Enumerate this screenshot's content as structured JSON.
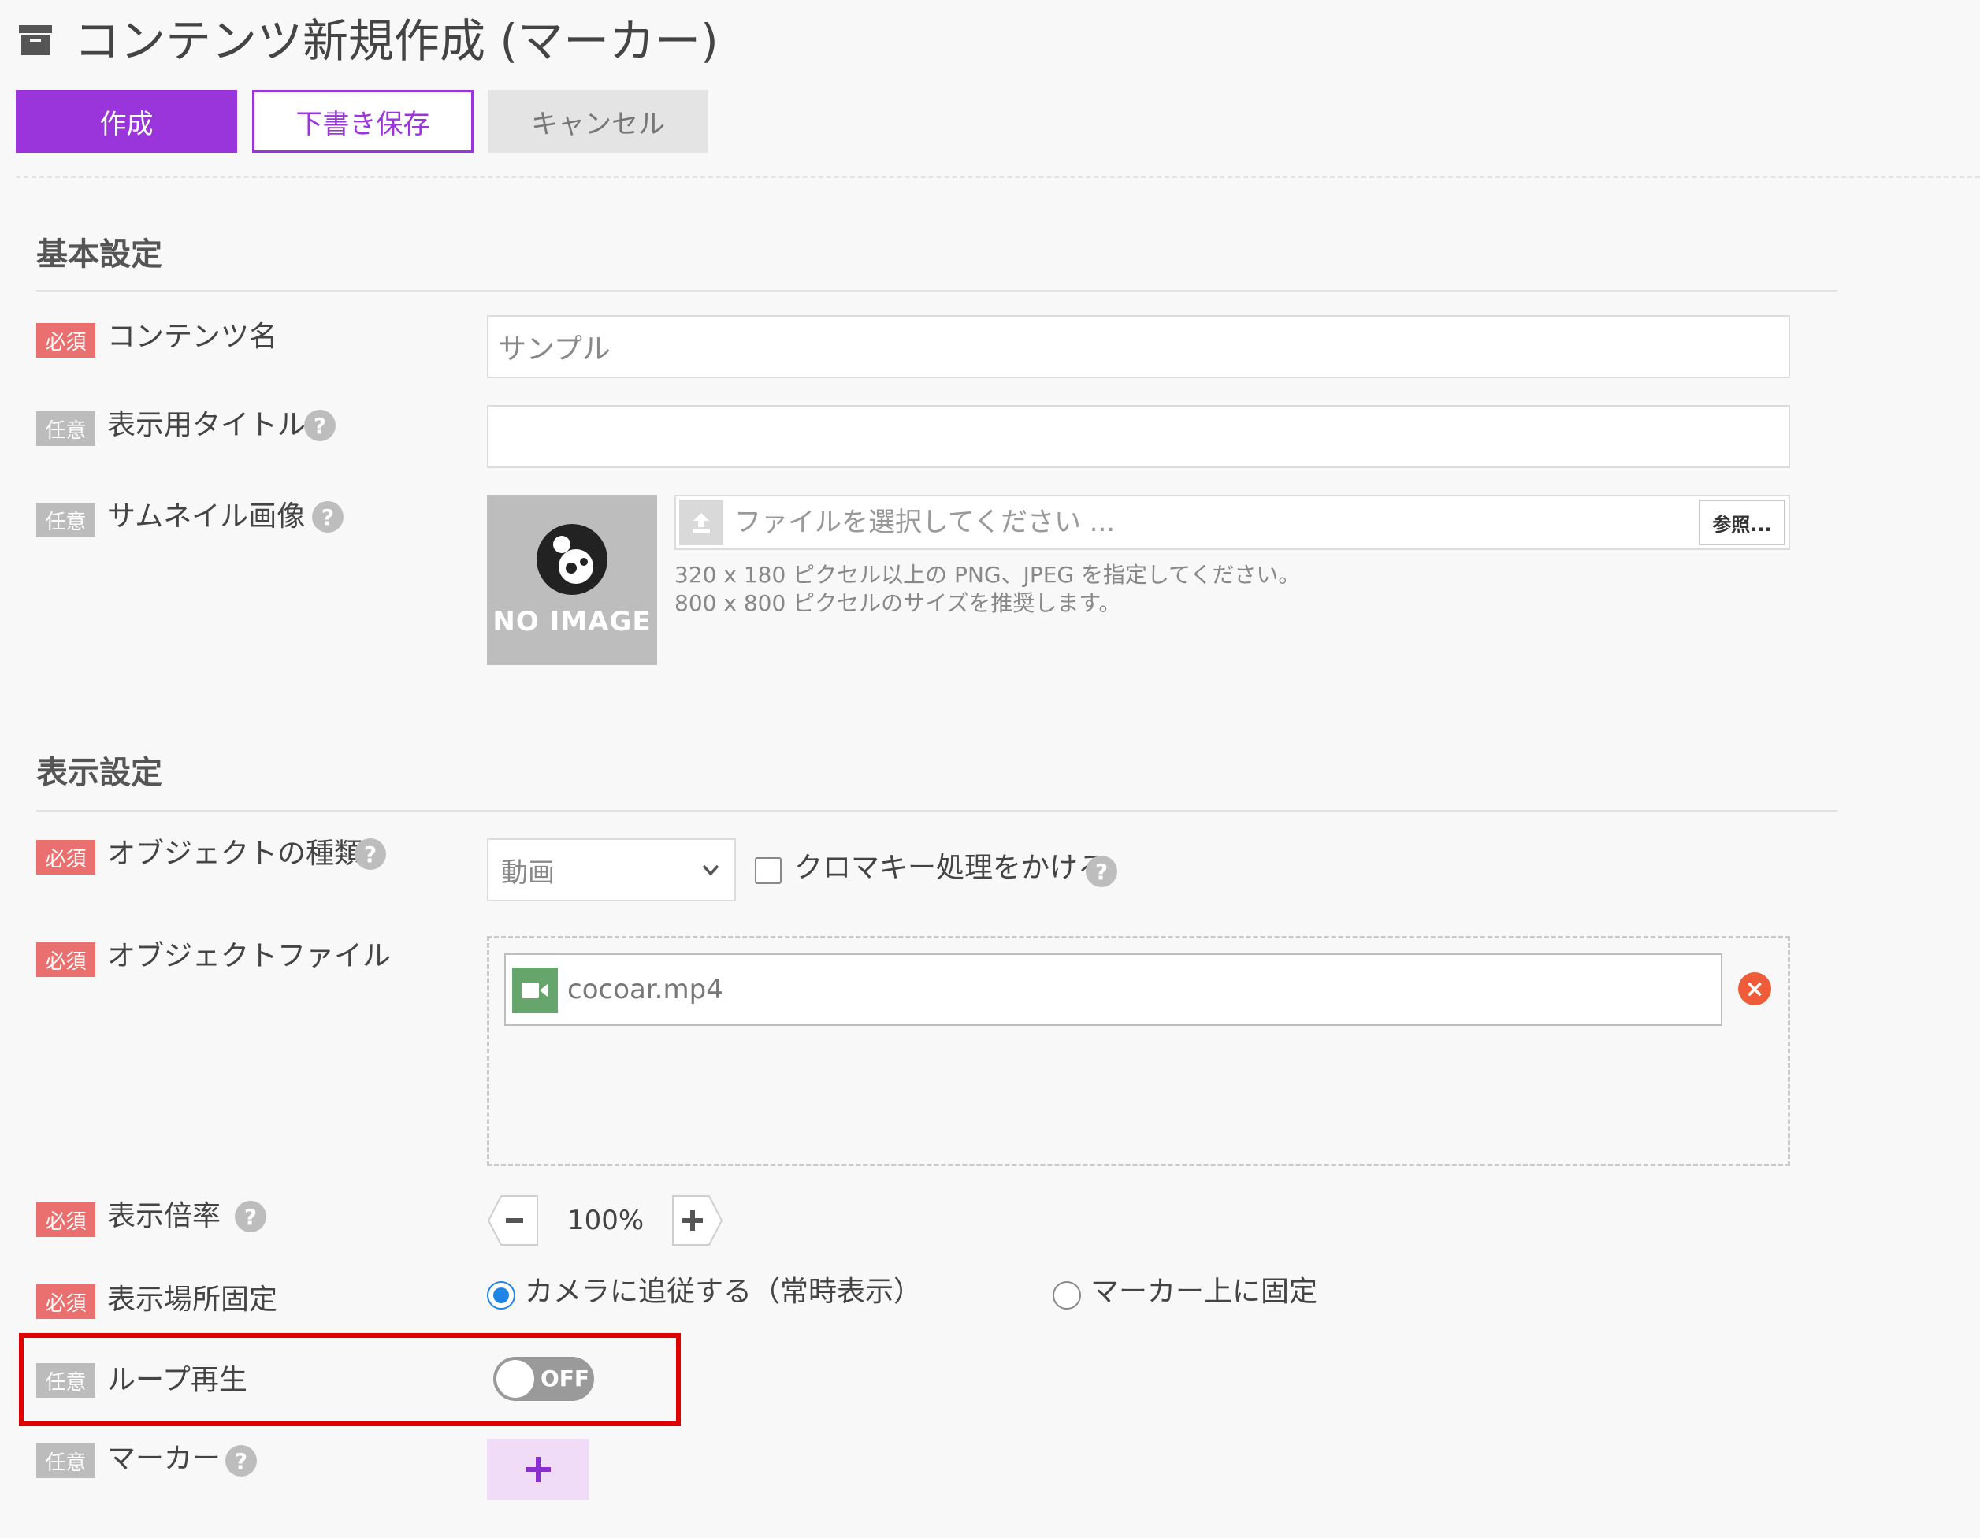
{
  "header": {
    "icon": "archive-box-icon",
    "title": "コンテンツ新規作成 (マーカー)"
  },
  "actions": {
    "create_label": "作成",
    "draft_label": "下書き保存",
    "cancel_label": "キャンセル"
  },
  "badges": {
    "required": "必須",
    "optional": "任意"
  },
  "basic_settings": {
    "title": "基本設定",
    "content_name": {
      "label": "コンテンツ名",
      "placeholder": "サンプル"
    },
    "display_title": {
      "label": "表示用タイトル",
      "value": ""
    },
    "thumbnail": {
      "label": "サムネイル画像",
      "no_image_text": "NO IMAGE",
      "file_placeholder": "ファイルを選択してください ...",
      "browse_label": "参照...",
      "hint_line1": "320 x 180 ピクセル以上の PNG、JPEG を指定してください。",
      "hint_line2": "800 x 800 ピクセルのサイズを推奨します。"
    }
  },
  "display_settings": {
    "title": "表示設定",
    "object_type": {
      "label": "オブジェクトの種類",
      "selected": "動画",
      "chroma_key_label": "クロマキー処理をかける",
      "chroma_key_checked": false
    },
    "object_file": {
      "label": "オブジェクトファイル",
      "file_name": "cocoar.mp4"
    },
    "scale": {
      "label": "表示倍率",
      "value": "100%"
    },
    "position": {
      "label": "表示場所固定",
      "option_camera": "カメラに追従する（常時表示）",
      "option_marker": "マーカー上に固定",
      "selected": "camera"
    },
    "loop": {
      "label": "ループ再生",
      "state_text": "OFF"
    },
    "marker": {
      "label": "マーカー"
    }
  },
  "help_symbol": "?",
  "colors": {
    "accent": "#9a35dc",
    "required_badge": "#e9706f",
    "optional_badge": "#bcbcbc",
    "highlight": "#e00000",
    "radio_selected": "#1d84e8"
  }
}
